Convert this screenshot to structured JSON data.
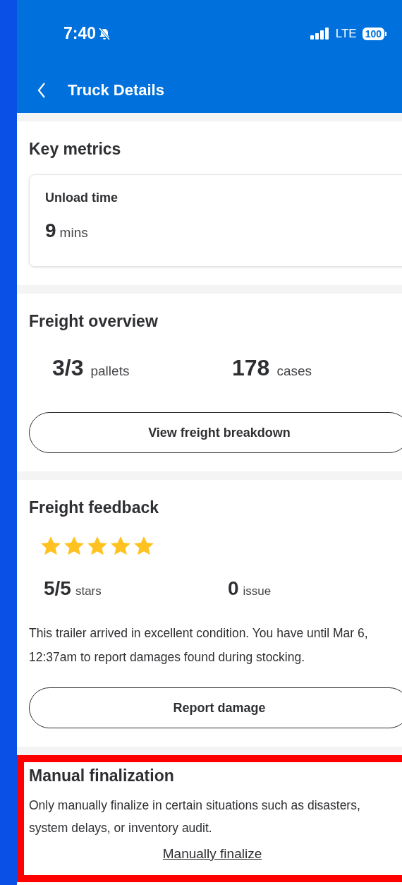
{
  "status_bar": {
    "time": "7:40",
    "network": "LTE",
    "battery": "100"
  },
  "nav": {
    "title": "Truck Details"
  },
  "key_metrics": {
    "title": "Key metrics",
    "label": "Unload time",
    "value": "9",
    "unit": "mins"
  },
  "freight_overview": {
    "title": "Freight overview",
    "stats": [
      {
        "value": "3/3",
        "unit": "pallets"
      },
      {
        "value": "178",
        "unit": "cases"
      }
    ],
    "button": "View freight breakdown"
  },
  "freight_feedback": {
    "title": "Freight feedback",
    "stars": 5,
    "stats": [
      {
        "value": "5/5",
        "unit": "stars"
      },
      {
        "value": "0",
        "unit": "issue"
      }
    ],
    "message": "This trailer arrived in excellent condition. You have until Mar 6, 12:37am to report damages found during stocking.",
    "button": "Report damage"
  },
  "manual_finalization": {
    "title": "Manual finalization",
    "description": "Only manually finalize in certain situations such as disasters, system delays, or inventory audit.",
    "link": "Manually finalize",
    "highlighted": true
  }
}
